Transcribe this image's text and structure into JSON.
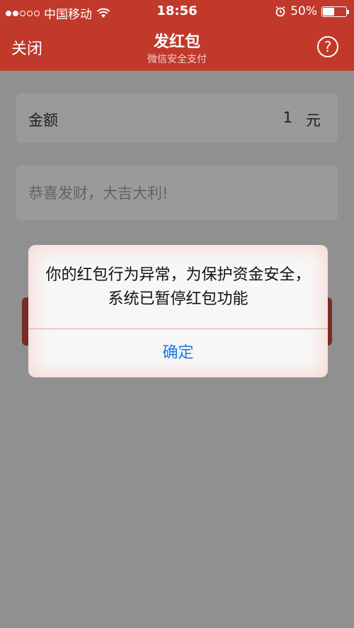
{
  "status_bar": {
    "carrier": "中国移动",
    "time": "18:56",
    "battery_percent": "50%",
    "battery_level": 0.5,
    "signal_bars": 2,
    "signal_total": 5,
    "icons": [
      "wifi-icon",
      "alarm-icon",
      "battery-icon"
    ]
  },
  "nav": {
    "close_label": "关闭",
    "title": "发红包",
    "subtitle": "微信安全支付",
    "help_label": "?"
  },
  "form": {
    "amount_label": "金额",
    "amount_value": "1",
    "amount_unit": "元",
    "message_placeholder": "恭喜发财，大吉大利!"
  },
  "alert": {
    "message": "你的红包行为异常，为保护资金安全，系统已暂停红包功能",
    "confirm_label": "确定"
  },
  "colors": {
    "brand_red": "#c0392b",
    "link_blue": "#1a7be0"
  }
}
